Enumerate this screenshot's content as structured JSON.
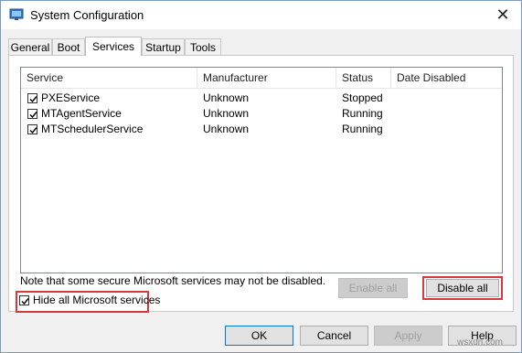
{
  "window": {
    "title": "System Configuration",
    "close_glyph": "✕"
  },
  "tabs": [
    {
      "label": "General"
    },
    {
      "label": "Boot"
    },
    {
      "label": "Services"
    },
    {
      "label": "Startup"
    },
    {
      "label": "Tools"
    }
  ],
  "services": {
    "columns": [
      "Service",
      "Manufacturer",
      "Status",
      "Date Disabled"
    ],
    "rows": [
      {
        "checked": true,
        "name": "PXEService",
        "manufacturer": "Unknown",
        "status": "Stopped",
        "date_disabled": ""
      },
      {
        "checked": true,
        "name": "MTAgentService",
        "manufacturer": "Unknown",
        "status": "Running",
        "date_disabled": ""
      },
      {
        "checked": true,
        "name": "MTSchedulerService",
        "manufacturer": "Unknown",
        "status": "Running",
        "date_disabled": ""
      }
    ],
    "note": "Note that some secure Microsoft services may not be disabled.",
    "enable_all": "Enable all",
    "disable_all": "Disable all",
    "hide_ms": {
      "label": "Hide all Microsoft services",
      "checked": true
    }
  },
  "footer": {
    "ok": "OK",
    "cancel": "Cancel",
    "apply": "Apply",
    "help": "Help"
  },
  "watermark": "wsxdn.com",
  "colors": {
    "highlight": "#d9383a",
    "focus": "#0078d7"
  }
}
